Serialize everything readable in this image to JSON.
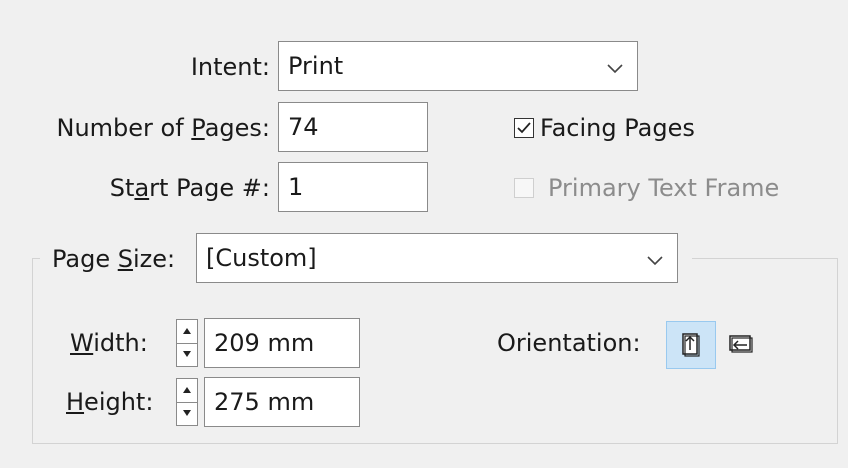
{
  "intent": {
    "label": "Intent:",
    "value": "Print"
  },
  "pages": {
    "label_pre": "Number of ",
    "label_u": "P",
    "label_post": "ages:",
    "value": "74"
  },
  "start_page": {
    "label_pre": "St",
    "label_u": "a",
    "label_post": "rt Page #:",
    "value": "1"
  },
  "facing_pages": {
    "label": "Facing Pages",
    "checked": true
  },
  "primary_text_frame": {
    "label": "Primary Text Frame",
    "checked": false,
    "enabled": false
  },
  "page_size": {
    "label_pre": "Page ",
    "label_u": "S",
    "label_post": "ize:",
    "value": "[Custom]"
  },
  "width": {
    "label_u": "W",
    "label_post": "idth:",
    "value": "209 mm"
  },
  "height": {
    "label_u": "H",
    "label_post": "eight:",
    "value": "275 mm"
  },
  "orientation": {
    "label": "Orientation:",
    "selected": "portrait"
  }
}
